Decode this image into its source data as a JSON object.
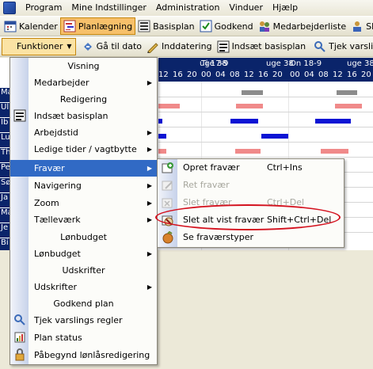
{
  "menubar": {
    "items": [
      "Program",
      "Mine Indstillinger",
      "Administration",
      "Vinduer",
      "Hjælp"
    ]
  },
  "toolbar1": {
    "buttons": [
      {
        "label": "Kalender",
        "icon": "calendar-icon"
      },
      {
        "label": "Planlægning",
        "icon": "planning-icon",
        "active": true
      },
      {
        "label": "Basisplan",
        "icon": "basisplan-icon"
      },
      {
        "label": "Godkend",
        "icon": "approve-icon"
      },
      {
        "label": "Medarbejderliste",
        "icon": "employee-list-icon"
      },
      {
        "label": "Skift afd",
        "icon": "switch-department-icon"
      }
    ]
  },
  "toolbar2": {
    "funktioner_label": "Funktioner",
    "buttons": [
      {
        "label": "Gå til dato",
        "icon": "goto-date-icon"
      },
      {
        "label": "Inddatering",
        "icon": "data-entry-icon"
      },
      {
        "label": "Indsæt basisplan",
        "icon": "insert-basisplan-icon"
      },
      {
        "label": "Tjek varslings r",
        "icon": "check-notice-icon"
      }
    ]
  },
  "schedule_header": {
    "day_labels": [
      "uge 38",
      "Ti 17-9",
      "uge 38",
      "On 18-9",
      "uge 38"
    ],
    "hours": [
      "12",
      "16",
      "20",
      "00",
      "04",
      "08",
      "12",
      "16",
      "20",
      "00",
      "04",
      "08",
      "12",
      "16",
      "20"
    ]
  },
  "name_cells": [
    "Ma",
    "Ul",
    "Ib",
    "Lu",
    "Th",
    "Pe",
    "Sø",
    "Ja",
    "Ma",
    "Je",
    "Bi"
  ],
  "dropdown": {
    "items": [
      {
        "label": "Visning",
        "type": "header"
      },
      {
        "label": "Medarbejder",
        "type": "submenu"
      },
      {
        "label": "Redigering",
        "type": "header"
      },
      {
        "label": "Indsæt basisplan",
        "type": "item",
        "icon": "insert-basisplan-icon"
      },
      {
        "label": "Arbejdstid",
        "type": "submenu"
      },
      {
        "label": "Ledige tider / vagtbytte",
        "type": "submenu"
      },
      {
        "label": "Fravær",
        "type": "submenu",
        "highlighted": true
      },
      {
        "label": "Navigering",
        "type": "submenu"
      },
      {
        "label": "Zoom",
        "type": "submenu"
      },
      {
        "label": "Tælleværk",
        "type": "submenu"
      },
      {
        "label": "Lønbudget",
        "type": "header"
      },
      {
        "label": "Lønbudget",
        "type": "submenu"
      },
      {
        "label": "Udskrifter",
        "type": "header"
      },
      {
        "label": "Udskrifter",
        "type": "submenu"
      },
      {
        "label": "Godkend plan",
        "type": "header"
      },
      {
        "label": "Tjek varslings regler",
        "type": "item",
        "icon": "check-notice-icon"
      },
      {
        "label": "Plan status",
        "type": "item",
        "icon": "plan-status-icon"
      },
      {
        "label": "Påbegynd lønlåsredigering",
        "type": "item",
        "icon": "payroll-lock-icon"
      }
    ]
  },
  "submenu": {
    "items": [
      {
        "label": "Opret fravær",
        "shortcut": "Ctrl+Ins",
        "enabled": true,
        "icon": "create-absence-icon"
      },
      {
        "label": "Ret fravær",
        "shortcut": "",
        "enabled": false,
        "icon": "edit-absence-icon"
      },
      {
        "label": "Slet fravær",
        "shortcut": "Ctrl+Del",
        "enabled": false,
        "icon": "delete-absence-icon"
      },
      {
        "label": "Slet alt vist fravær",
        "shortcut": "Shift+Ctrl+Del",
        "enabled": true,
        "icon": "delete-all-absence-icon"
      },
      {
        "label": "Se fraværstyper",
        "shortcut": "",
        "enabled": true,
        "icon": "absence-types-icon"
      }
    ]
  },
  "colors": {
    "header_blue": "#0a246a",
    "selection": "#316ac5",
    "bar_red": "#f08a8a",
    "bar_blue": "#0b14d4",
    "bar_gray": "#8c8c8c",
    "annotation_red": "#d4121f"
  }
}
